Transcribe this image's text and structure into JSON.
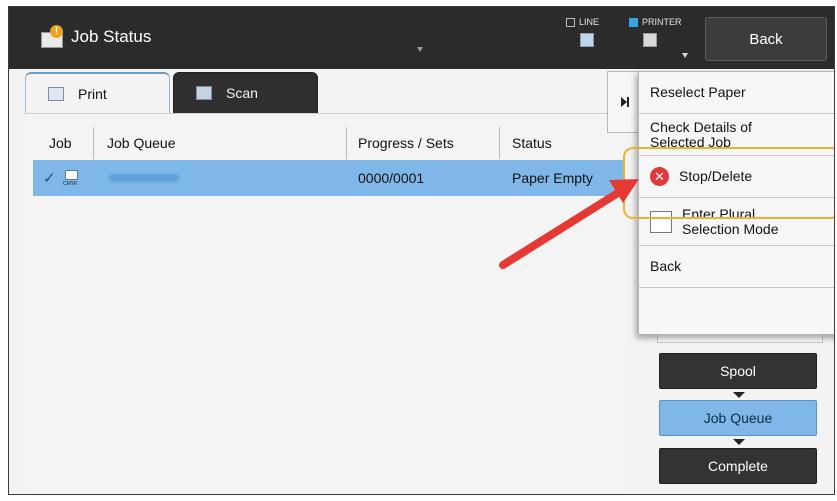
{
  "header": {
    "title": "Job Status",
    "modes": [
      {
        "label": "LINE",
        "active": false
      },
      {
        "label": "PRINTER",
        "active": true
      }
    ],
    "back_label": "Back"
  },
  "tabs": [
    {
      "label": "Print",
      "active": true
    },
    {
      "label": "Scan",
      "active": false
    }
  ],
  "table": {
    "columns": [
      "Job",
      "Job Queue",
      "Progress / Sets",
      "Status"
    ],
    "rows": [
      {
        "job_icon": "print-job-icon",
        "color_mode": "CMYK",
        "queue_name": "(blurred)",
        "progress": "0000/0001",
        "status": "Paper Empty",
        "selected": true
      }
    ]
  },
  "menu": {
    "items": [
      {
        "label": "Reselect Paper"
      },
      {
        "label": "Check Details of Selected Job"
      },
      {
        "label": "Stop/Delete"
      },
      {
        "label": "Enter Plural Selection Mode"
      },
      {
        "label": "Back"
      }
    ]
  },
  "queue_flow": {
    "buttons": [
      "Spool",
      "Job Queue",
      "Complete"
    ],
    "selected": "Job Queue"
  },
  "colors": {
    "topbar": "#2b2b2b",
    "selection": "#7fb8e8",
    "highlight_box": "#e9b233",
    "annotation_arrow": "#e53935",
    "stop_icon": "#e23a3a"
  }
}
